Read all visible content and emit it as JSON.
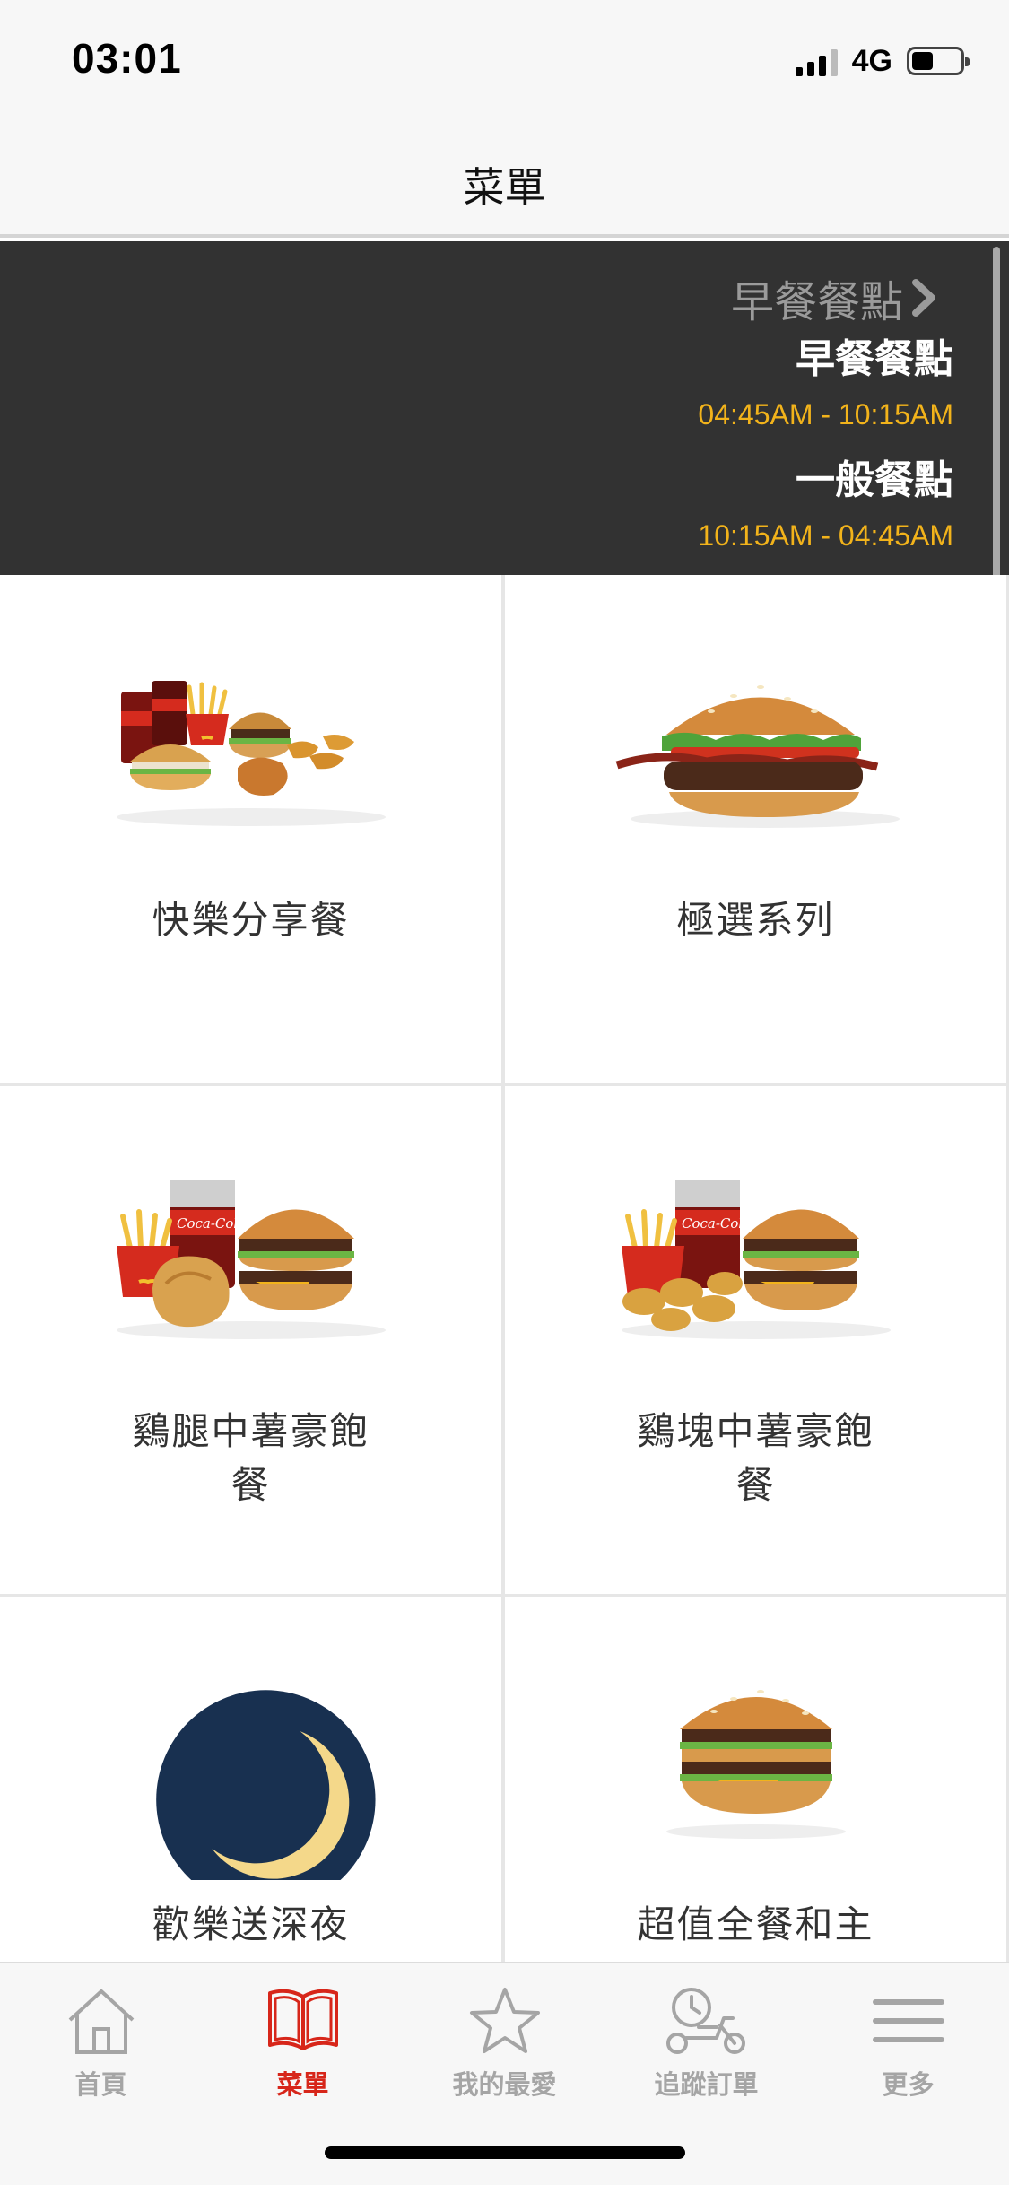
{
  "status_bar": {
    "time": "03:01",
    "network": "4G",
    "battery_level": 0.45
  },
  "nav": {
    "title": "菜單"
  },
  "meal_banner": {
    "toggle_label": "早餐餐點",
    "rows": [
      {
        "title": "早餐餐點",
        "time": "04:45AM - 10:15AM"
      },
      {
        "title": "一般餐點",
        "time": "10:15AM - 04:45AM"
      }
    ]
  },
  "menu": {
    "items": [
      {
        "label": "快樂分享餐",
        "icon": "family-meal-image"
      },
      {
        "label": "極選系列",
        "icon": "signature-burger-image"
      },
      {
        "label": "鷄腿中薯豪飽餐",
        "icon": "chicken-combo-image"
      },
      {
        "label": "鷄塊中薯豪飽餐",
        "icon": "nugget-combo-image"
      },
      {
        "label": "歡樂送深夜",
        "icon": "moon-icon"
      },
      {
        "label": "超值全餐和主",
        "icon": "big-mac-image"
      }
    ]
  },
  "tab_bar": {
    "tabs": [
      {
        "label": "首頁",
        "icon": "home-icon"
      },
      {
        "label": "菜單",
        "icon": "book-icon",
        "active": true
      },
      {
        "label": "我的最愛",
        "icon": "star-icon"
      },
      {
        "label": "追蹤訂單",
        "icon": "scooter-icon"
      },
      {
        "label": "更多",
        "icon": "menu-lines-icon"
      }
    ]
  },
  "colors": {
    "accent_red": "#d7261a",
    "accent_gold": "#f2b31b",
    "banner_bg": "#323232",
    "moon_bg": "#183050"
  }
}
